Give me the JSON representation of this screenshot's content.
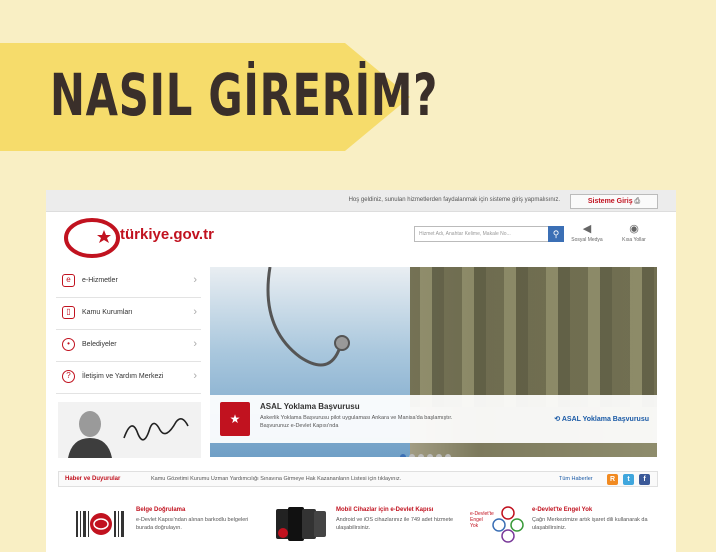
{
  "banner": {
    "title": "NASIL GİRERİM?"
  },
  "site": {
    "topbar": {
      "welcome": "Hoş geldiniz, sunulan hizmetlerden faydalanmak için sisteme giriş yapmalısınız.",
      "login_label": "Sisteme Giriş"
    },
    "header": {
      "logo_text": "türkiye.gov.tr",
      "search_placeholder": "Hizmet Adı, Anahtar Kelime, Makale No...",
      "social_media_label": "Sosyal Medya",
      "hint_label": "Kısa Yollar"
    },
    "sidebar": {
      "items": [
        {
          "label": "e-Hizmetler"
        },
        {
          "label": "Kamu Kurumları"
        },
        {
          "label": "Belediyeler"
        },
        {
          "label": "İletişim ve Yardım Merkezi"
        }
      ]
    },
    "slider": {
      "caption_title": "ASAL Yoklama Başvurusu",
      "caption_text": "Askerlik Yoklama Başvurusu pilot uygulaması Ankara ve Manisa'da başlamıştır. Başvurunuz e-Devlet Kapısı'nda",
      "caption_link": "ASAL Yoklama Başvurusu",
      "dot_count": 6
    },
    "news": {
      "title": "Haber ve Duyurular",
      "text": "Kamu Gözetimi Kurumu Uzman Yardımcılığı Sınavına Girmeye Hak Kazananların Listesi için tıklayınız.",
      "all_link": "Tüm Haberler"
    },
    "features": [
      {
        "title": "Belge Doğrulama",
        "text": "e-Devlet Kapısı'ndan alınan barkodlu belgeleri burada doğrulayın."
      },
      {
        "title": "Mobil Cihazlar için e-Devlet Kapısı",
        "text": "Android ve iOS cihazlarınız ile 749 adet hizmete ulaşabilirsiniz."
      },
      {
        "title": "e-Devlet'te Engel Yok",
        "text": "Çağrı Merkezimize artık işaret dili kullanarak da ulaşabilirsiniz."
      }
    ],
    "colors": {
      "brand_red": "#c1121f",
      "link_blue": "#1a5aa6",
      "banner_yellow": "#f6dc6b"
    }
  }
}
